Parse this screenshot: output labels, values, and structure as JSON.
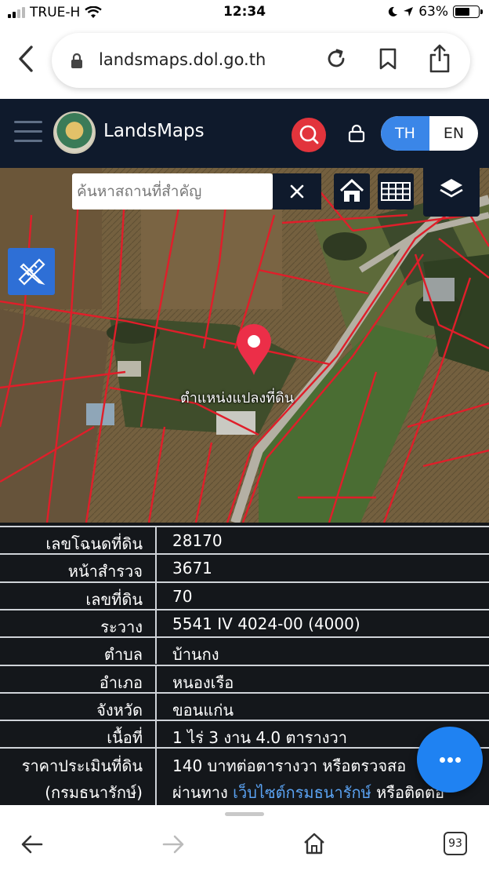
{
  "status": {
    "carrier": "TRUE-H",
    "time": "12:34",
    "battery": "63%",
    "battery_level": 0.63
  },
  "browser": {
    "url": "landsmaps.dol.go.th",
    "tab_count": "93"
  },
  "header": {
    "app_name": "LandsMaps",
    "lang_th": "TH",
    "lang_en": "EN",
    "active_lang": "TH"
  },
  "map": {
    "search_placeholder": "ค้นหาสถานที่สำคัญ",
    "parcel_label": "ตำแหน่งแปลงที่ดิน"
  },
  "info": {
    "rows": [
      {
        "label": "เลขโฉนดที่ดิน",
        "value": "28170"
      },
      {
        "label": "หน้าสำรวจ",
        "value": "3671"
      },
      {
        "label": "เลขที่ดิน",
        "value": "70"
      },
      {
        "label": "ระวาง",
        "value": "5541 IV 4024-00 (4000)"
      },
      {
        "label": "ตำบล",
        "value": "บ้านกง"
      },
      {
        "label": "อำเภอ",
        "value": "หนองเรือ"
      },
      {
        "label": "จังหวัด",
        "value": "ขอนแก่น"
      },
      {
        "label": "เนื้อที่",
        "value": "1 ไร่ 3 งาน 4.0 ตารางวา"
      }
    ],
    "price_label_1": "ราคาประเมินที่ดิน",
    "price_label_2": "(กรมธนารักษ์)",
    "price_value_1": "140 บาทต่อตารางวา หรือตรวจสอ",
    "price_value_2_pre": "ผ่านทาง ",
    "price_value_2_link": "เว็บไซต์กรมธนารักษ์",
    "price_value_2_post": " หรือติดต่อ"
  }
}
